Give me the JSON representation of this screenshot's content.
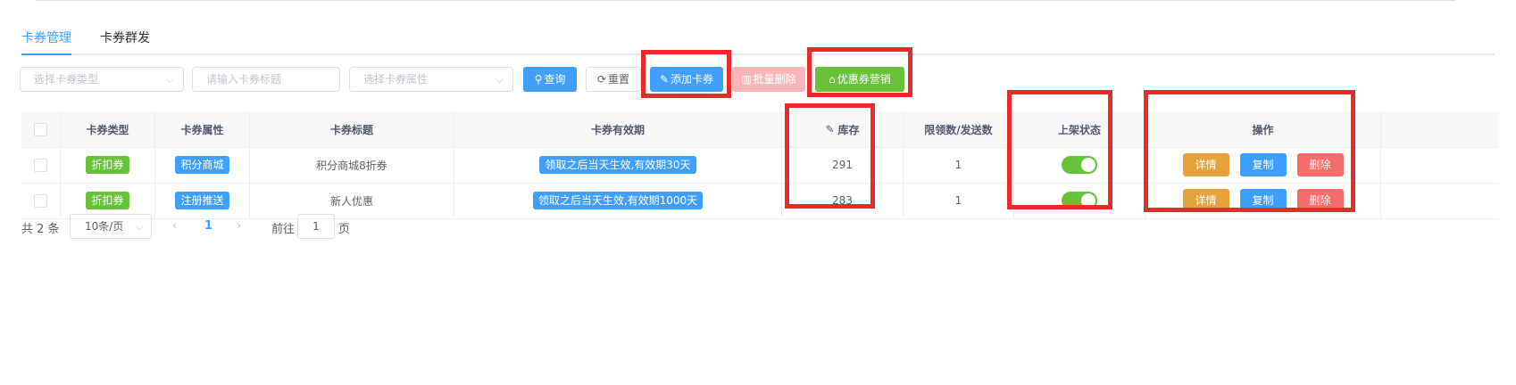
{
  "tabs": [
    {
      "label": "卡券管理"
    },
    {
      "label": "卡券群发"
    }
  ],
  "toolbar": {
    "type_select_placeholder": "选择卡券类型",
    "title_input_placeholder": "请输入卡券标题",
    "attr_select_placeholder": "选择卡券属性",
    "query_label": "查询",
    "reset_label": "重置",
    "add_label": "添加卡券",
    "batch_delete_label": "批量删除",
    "marketing_label": "优惠券营销"
  },
  "table": {
    "columns": [
      "卡券类型",
      "卡券属性",
      "卡券标题",
      "卡券有效期",
      "库存",
      "限领数/发送数",
      "上架状态",
      "操作"
    ],
    "rows": [
      {
        "type": "折扣券",
        "attr": "积分商城",
        "title": "积分商城8折券",
        "validity": "领取之后当天生效,有效期30天",
        "stock": "291",
        "limit": "1",
        "on_shelf": true
      },
      {
        "type": "折扣券",
        "attr": "注册推送",
        "title": "新人优惠",
        "validity": "领取之后当天生效,有效期1000天",
        "stock": "283",
        "limit": "1",
        "on_shelf": true
      }
    ],
    "actions": {
      "detail": "详情",
      "copy": "复制",
      "delete": "删除"
    }
  },
  "pagination": {
    "total_text": "共 2 条",
    "page_size": "10条/页",
    "current_page": "1",
    "goto_prefix": "前往",
    "goto_value": "1",
    "goto_suffix": "页"
  },
  "colors": {
    "primary": "#409eff",
    "success": "#67c23a",
    "warning": "#e6a23c",
    "danger": "#f56c6c",
    "highlight": "#ea2b2b"
  }
}
